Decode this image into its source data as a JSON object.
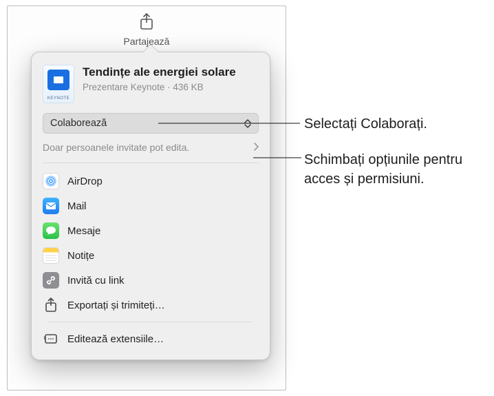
{
  "toolbar": {
    "share_label": "Partajează"
  },
  "document": {
    "title": "Tendințe ale energiei solare",
    "subtitle": "Prezentare Keynote · 436 KB",
    "icon_caption": "KEYNOTE"
  },
  "mode_selector": {
    "label": "Colaborează"
  },
  "permissions": {
    "text": "Doar persoanele invitate pot edita."
  },
  "options": {
    "airdrop": "AirDrop",
    "mail": "Mail",
    "messages": "Mesaje",
    "notes": "Notițe",
    "invite_link": "Invită cu link",
    "export_send": "Exportați și trimiteți…",
    "edit_extensions": "Editează extensiile…"
  },
  "callouts": {
    "select_collaborate": "Selectați Colaborați.",
    "change_permissions": "Schimbați opțiunile pentru acces și permisiuni."
  }
}
